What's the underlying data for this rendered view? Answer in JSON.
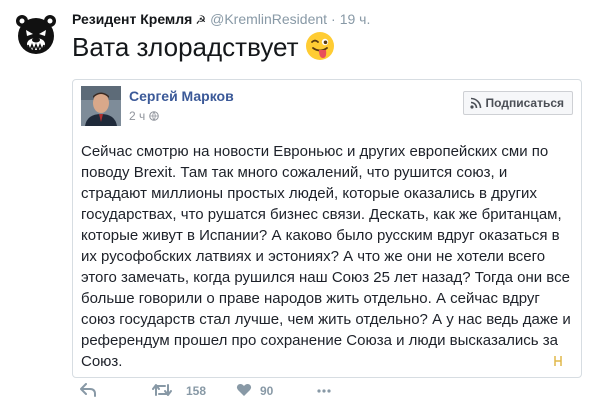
{
  "tweet": {
    "author_name": "Резидент Кремля",
    "author_symbol": "☭",
    "handle": "@KremlinResident",
    "separator": "·",
    "time": "19 ч.",
    "text": "Вата злорадствует",
    "emoji": "winking-face-with-tongue",
    "embed": {
      "author": "Сергей Марков",
      "time": "2 ч",
      "subscribe_label": "Подписаться",
      "body": "Сейчас смотрю на новости Евроньюс и других европейских сми по поводу Brexit. Там так много сожалений, что рушится союз, и страдают миллионы простых людей, которые оказались в других государствах, что рушатся бизнес связи. Дескать, как же британцам, которые живут в Испании? А каково было русским вдруг оказаться в их русофобских латвиях и эстониях? А что же они не хотели всего этого замечать, когда рушился наш Союз 25 лет назад? Тогда они все больше говорили о праве народов жить отдельно. А сейчас вдруг союз государств стал лучше, чем жить отдельно? А у нас ведь даже и референдум прошел про сохранение Союза и люди высказались за Союз."
    },
    "actions": {
      "reply_icon": "reply-icon",
      "retweet_count": "158",
      "like_count": "90"
    }
  },
  "colors": {
    "text": "#14171a",
    "muted": "#8899a6",
    "facebook_blue": "#3b5998",
    "border": "#d7dde2"
  }
}
